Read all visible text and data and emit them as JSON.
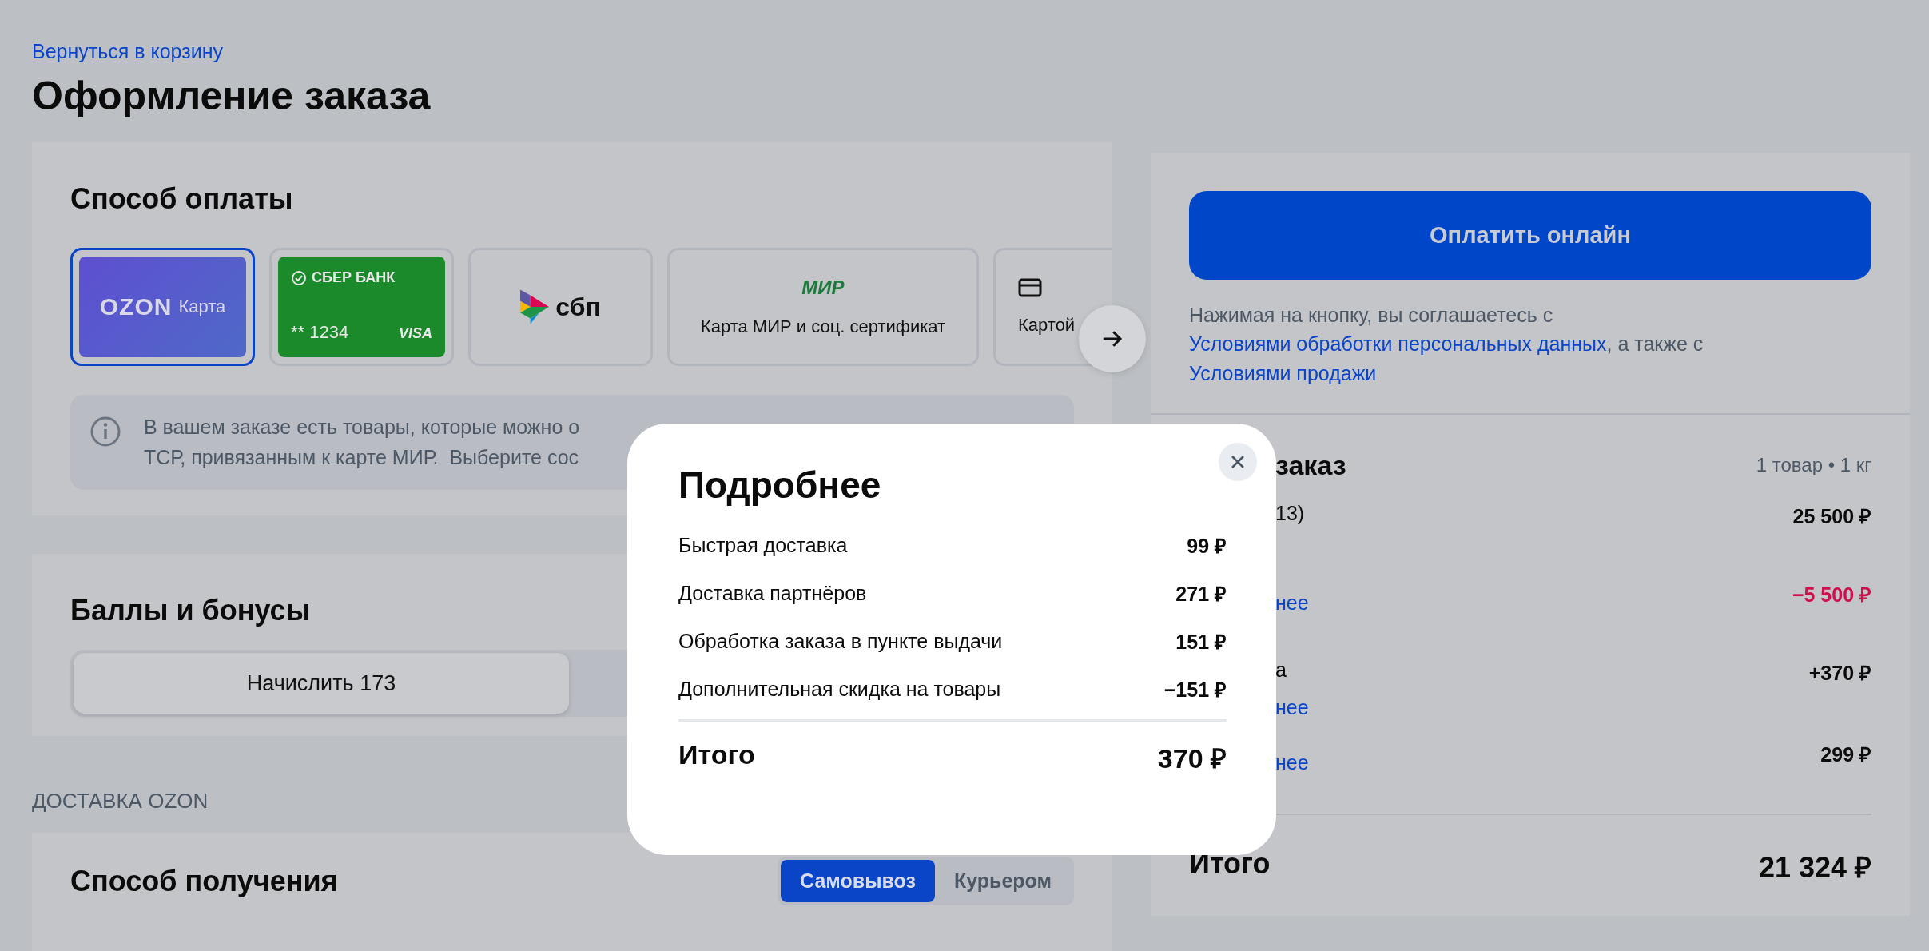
{
  "back_link": "Вернуться в корзину",
  "title": "Оформление заказа",
  "payment": {
    "title": "Способ оплаты",
    "methods": [
      {
        "kind": "ozon-card",
        "brand": "OZON",
        "label": "Карта",
        "selected": true
      },
      {
        "kind": "bank-card",
        "bank": "СБЕР БАНК",
        "number": "** 1234",
        "network": "VISA",
        "selected": false
      },
      {
        "kind": "sbp",
        "label": "сбп",
        "selected": false
      },
      {
        "kind": "mir",
        "logo": "МИР",
        "label": "Карта МИР и соц. сертификат",
        "selected": false
      },
      {
        "kind": "other",
        "label": "Картой",
        "selected": false
      }
    ],
    "notice": [
      "В вашем заказе есть товары, которые можно о",
      "ТСР, привязанным к карте МИР.  Выберите сос"
    ]
  },
  "bonuses": {
    "title": "Баллы и бонусы",
    "options": [
      {
        "label": "Начислить 173",
        "selected": true
      }
    ]
  },
  "delivery_section": "ДОСТАВКА OZON",
  "receipt": {
    "title": "Способ получения",
    "options": [
      {
        "label": "Самовывоз",
        "selected": true
      },
      {
        "label": "Курьером",
        "selected": false
      }
    ]
  },
  "checkout": {
    "pay_button": "Оплатить онлайн",
    "terms": [
      {
        "kind": "text",
        "text": "Нажимая на кнопку, вы соглашаетесь с "
      },
      {
        "kind": "link",
        "text": "Условиями обработки персональных данных"
      },
      {
        "kind": "text",
        "text": ", а также с "
      },
      {
        "kind": "link",
        "text": "Условиями продажи"
      }
    ]
  },
  "order": {
    "title": "заказ",
    "meta": "1 товар • 1 кг",
    "lines": [
      {
        "kind": "price",
        "label": "13)",
        "value": "25 500 ₽"
      },
      {
        "kind": "discount",
        "value": "−5 500 ₽",
        "link": "нее"
      },
      {
        "kind": "price",
        "label": "а",
        "value": "+370 ₽",
        "link": "нее"
      },
      {
        "kind": "price",
        "value": "299 ₽",
        "link": "нее"
      }
    ],
    "total_label": "Итого",
    "total_value": "21 324 ₽"
  },
  "details_modal": {
    "title": "Подробнее",
    "rows": [
      {
        "label": "Быстрая доставка",
        "value": "99 ₽"
      },
      {
        "label": "Доставка партнёров",
        "value": "271 ₽"
      },
      {
        "label": "Обработка заказа в пункте выдачи",
        "value": "151 ₽"
      },
      {
        "label": "Дополнительная скидка на товары",
        "value": "−151 ₽"
      }
    ],
    "total_label": "Итого",
    "total_value": "370 ₽"
  }
}
